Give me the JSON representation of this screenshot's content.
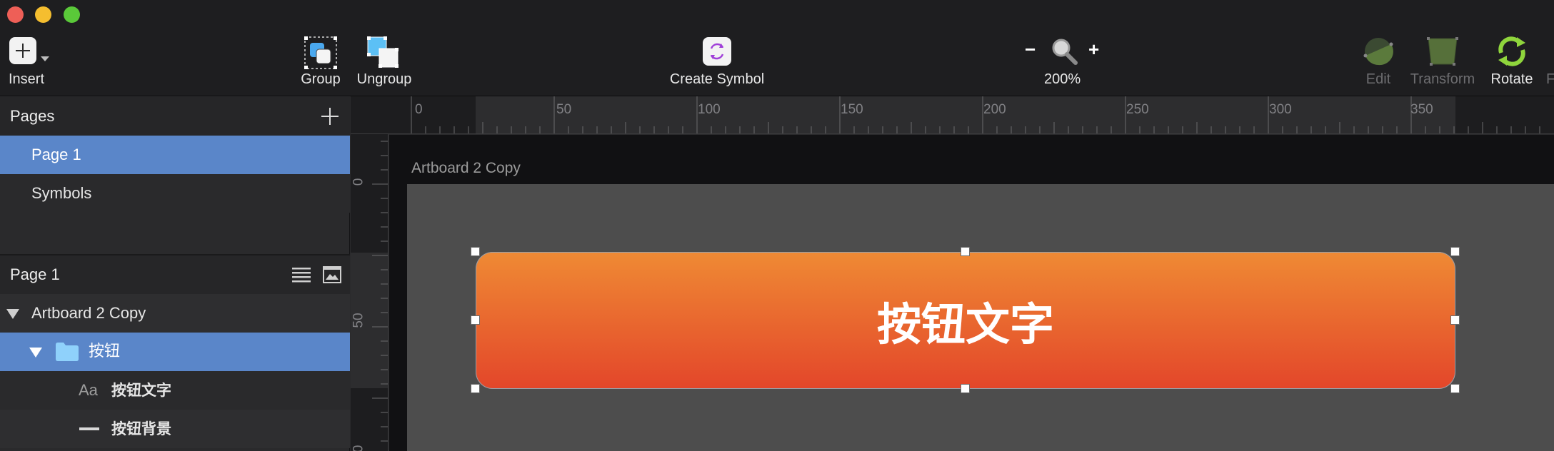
{
  "toolbar": {
    "insert_label": "Insert",
    "group_label": "Group",
    "ungroup_label": "Ungroup",
    "create_symbol_label": "Create Symbol",
    "zoom_minus": "−",
    "zoom_plus": "+",
    "zoom_level": "200%",
    "edit_label": "Edit",
    "transform_label": "Transform",
    "rotate_label": "Rotate",
    "cut_label": "F"
  },
  "pages_panel": {
    "title": "Pages",
    "pages": [
      "Page 1",
      "Symbols"
    ],
    "selected_page": "Page 1"
  },
  "layers_panel": {
    "page_title": "Page 1",
    "artboard": "Artboard 2 Copy",
    "group": "按钮",
    "text_layer_icon": "Aa",
    "text_layer": "按钮文字",
    "shape_layer": "按钮背景"
  },
  "rulers": {
    "top_ticks": [
      "0",
      "50",
      "100",
      "150",
      "200",
      "250",
      "300",
      "350"
    ],
    "left_ticks": [
      "0",
      "50",
      "0"
    ]
  },
  "canvas": {
    "artboard_name": "Artboard 2 Copy",
    "button_text": "按钮文字"
  },
  "colors": {
    "button_top": "#ef8a34",
    "button_bottom": "#e3462a",
    "selection": "#5a86c9"
  }
}
